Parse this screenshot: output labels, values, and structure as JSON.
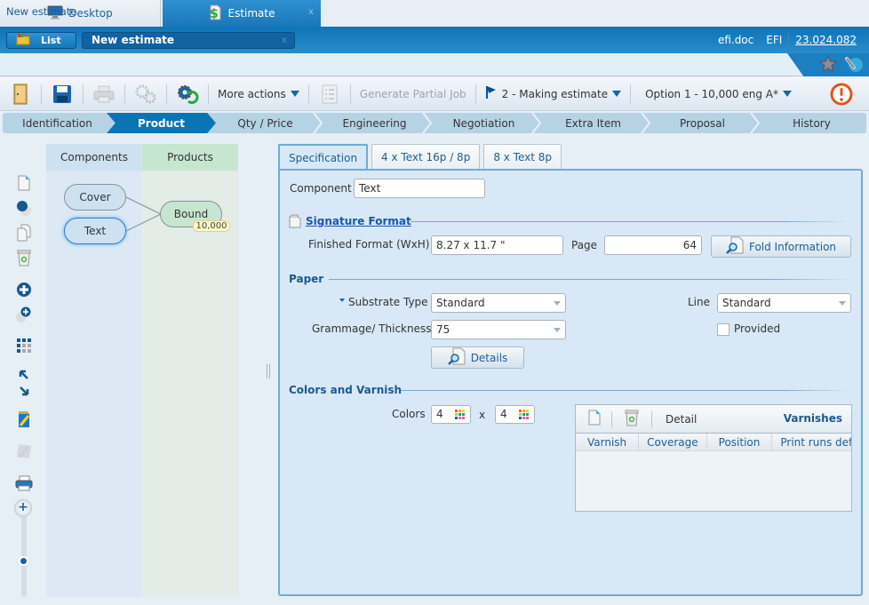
{
  "app_tabs": [
    {
      "label": "Desktop",
      "icon": "monitor-icon"
    },
    {
      "label": "Estimate",
      "icon": "dollar-document-icon",
      "close": "x"
    }
  ],
  "header": {
    "list_label": "List",
    "document_label": "New estimate",
    "document_close": "x",
    "user_domain": "efi.doc",
    "company": "EFI",
    "version": "23.024.082"
  },
  "breadcrumb": "New estimate",
  "toolbar": {
    "more_actions": "More actions",
    "generate_partial_job": "Generate Partial Job",
    "status": "2 - Making estimate",
    "option": "Option 1 - 10,000 eng A*"
  },
  "steps": [
    {
      "label": "Identification",
      "active": false
    },
    {
      "label": "Product",
      "active": true
    },
    {
      "label": "Qty / Price",
      "active": false
    },
    {
      "label": "Engineering",
      "active": false
    },
    {
      "label": "Negotiation",
      "active": false
    },
    {
      "label": "Extra Item",
      "active": false
    },
    {
      "label": "Proposal",
      "active": false
    },
    {
      "label": "History",
      "active": false
    }
  ],
  "graph": {
    "components_header": "Components",
    "products_header": "Products",
    "components": [
      "Cover",
      "Text"
    ],
    "selected_component": "Text",
    "product": "Bound",
    "product_quantity": "10,000"
  },
  "detail_tabs": [
    "Specification",
    "4 x Text 16p / 8p",
    "8 x Text  8p"
  ],
  "spec": {
    "component_label": "Component",
    "component_value": "Text",
    "signature_format_title": "Signature Format",
    "finished_format_label": "Finished Format (WxH)",
    "finished_format_value": "8.27 x 11.7 \"",
    "page_label": "Page",
    "page_value": "64",
    "fold_info_button": "Fold Information",
    "paper_title": "Paper",
    "substrate_label": "Substrate Type",
    "substrate_value": "Standard",
    "line_label": "Line",
    "line_value": "Standard",
    "grammage_label": "Grammage/ Thickness",
    "grammage_value": "75",
    "provided_label": "Provided",
    "provided_checked": false,
    "details_button": "Details",
    "colors_title": "Colors and Varnish",
    "colors_label": "Colors",
    "colors_front": "4",
    "colors_x": "x",
    "colors_back": "4"
  },
  "varnishes": {
    "title": "Varnishes",
    "detail_label": "Detail",
    "columns": [
      "Varnish",
      "Coverage",
      "Position",
      "Print runs defined"
    ],
    "rows": []
  }
}
